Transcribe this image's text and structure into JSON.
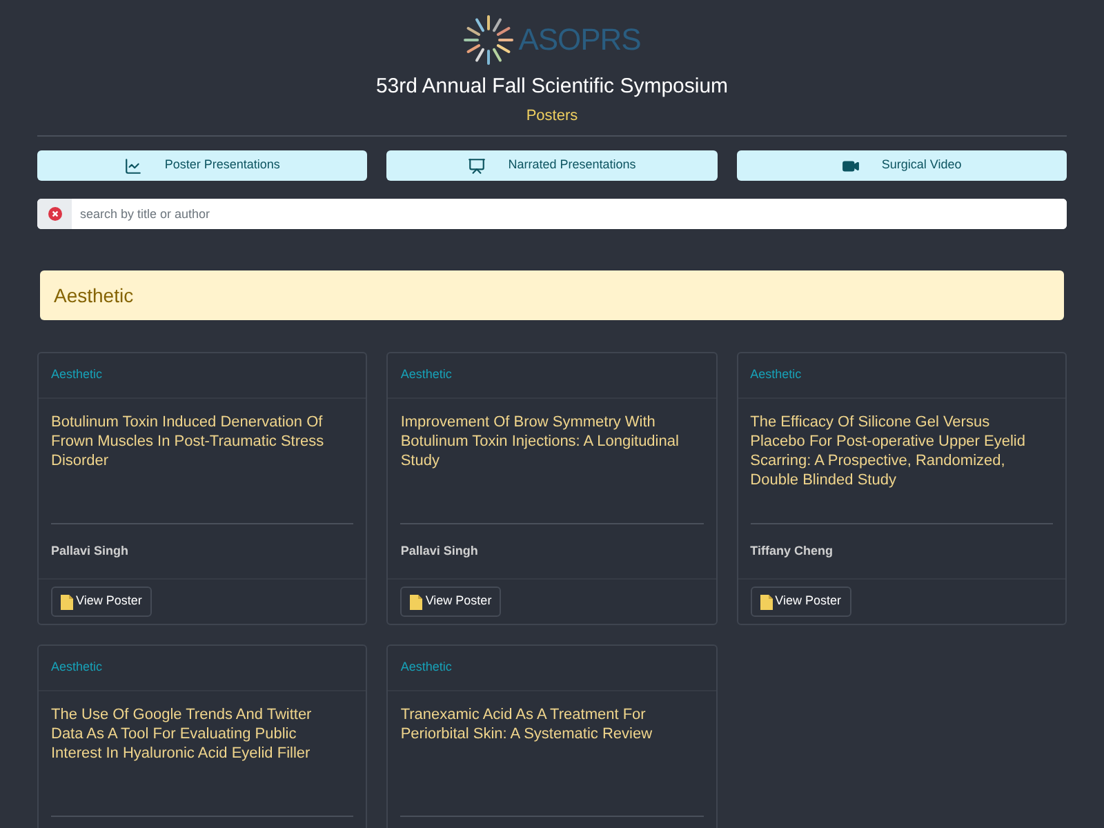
{
  "logo": {
    "text": "ASOPRS"
  },
  "title": "53rd Annual Fall Scientific Symposium",
  "subtitle": "Posters",
  "nav_buttons": [
    {
      "label": "Poster Presentations",
      "kind": "chart"
    },
    {
      "label": "Narrated Presentations",
      "kind": "presentation"
    },
    {
      "label": "Surgical Video",
      "kind": "video"
    }
  ],
  "search": {
    "placeholder": "search by title or author"
  },
  "section": {
    "title": "Aesthetic"
  },
  "cards": [
    {
      "category": "Aesthetic",
      "title": "Botulinum Toxin Induced Denervation Of Frown Muscles In Post-Traumatic Stress Disorder",
      "author": "Pallavi Singh",
      "button": "View Poster"
    },
    {
      "category": "Aesthetic",
      "title": "Improvement Of Brow Symmetry With Botulinum Toxin Injections: A Longitudinal Study",
      "author": "Pallavi Singh",
      "button": "View Poster"
    },
    {
      "category": "Aesthetic",
      "title": "The Efficacy Of Silicone Gel Versus Placebo For Post-operative Upper Eyelid Scarring: A Prospective, Randomized, Double Blinded Study",
      "author": "Tiffany Cheng",
      "button": "View Poster"
    },
    {
      "category": "Aesthetic",
      "title": "The Use Of Google Trends And Twitter Data As A Tool For Evaluating Public Interest In Hyaluronic Acid Eyelid Filler"
    },
    {
      "category": "Aesthetic",
      "title": "Tranexamic Acid As A Treatment For Periorbital Skin: A Systematic Review"
    }
  ]
}
